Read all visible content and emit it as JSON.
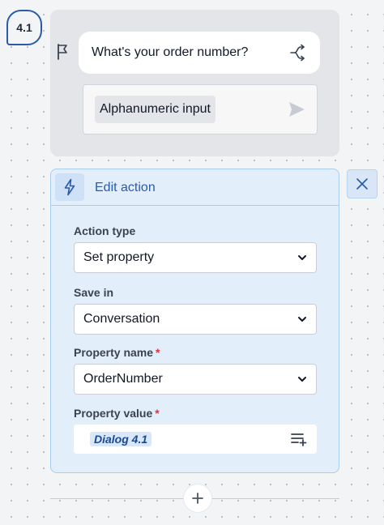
{
  "step": {
    "label": "4.1"
  },
  "dialog": {
    "question": "What's your order number?",
    "input_type": "Alphanumeric input"
  },
  "edit_action": {
    "title": "Edit action",
    "fields": [
      {
        "label": "Action type",
        "value": "Set property",
        "required": false
      },
      {
        "label": "Save in",
        "value": "Conversation",
        "required": false
      },
      {
        "label": "Property name",
        "value": "OrderNumber",
        "required": true
      }
    ],
    "property_value": {
      "label": "Property value",
      "required": true,
      "chip": "Dialog 4.1"
    }
  },
  "icons": [
    "flag-icon",
    "branch-icon",
    "send-icon",
    "bolt-icon",
    "close-icon",
    "chevron-down-icon",
    "list-add-icon",
    "plus-icon"
  ],
  "colors": {
    "accent": "#2a5aa8",
    "required": "#e0323c",
    "panel": "#e3eefb"
  }
}
